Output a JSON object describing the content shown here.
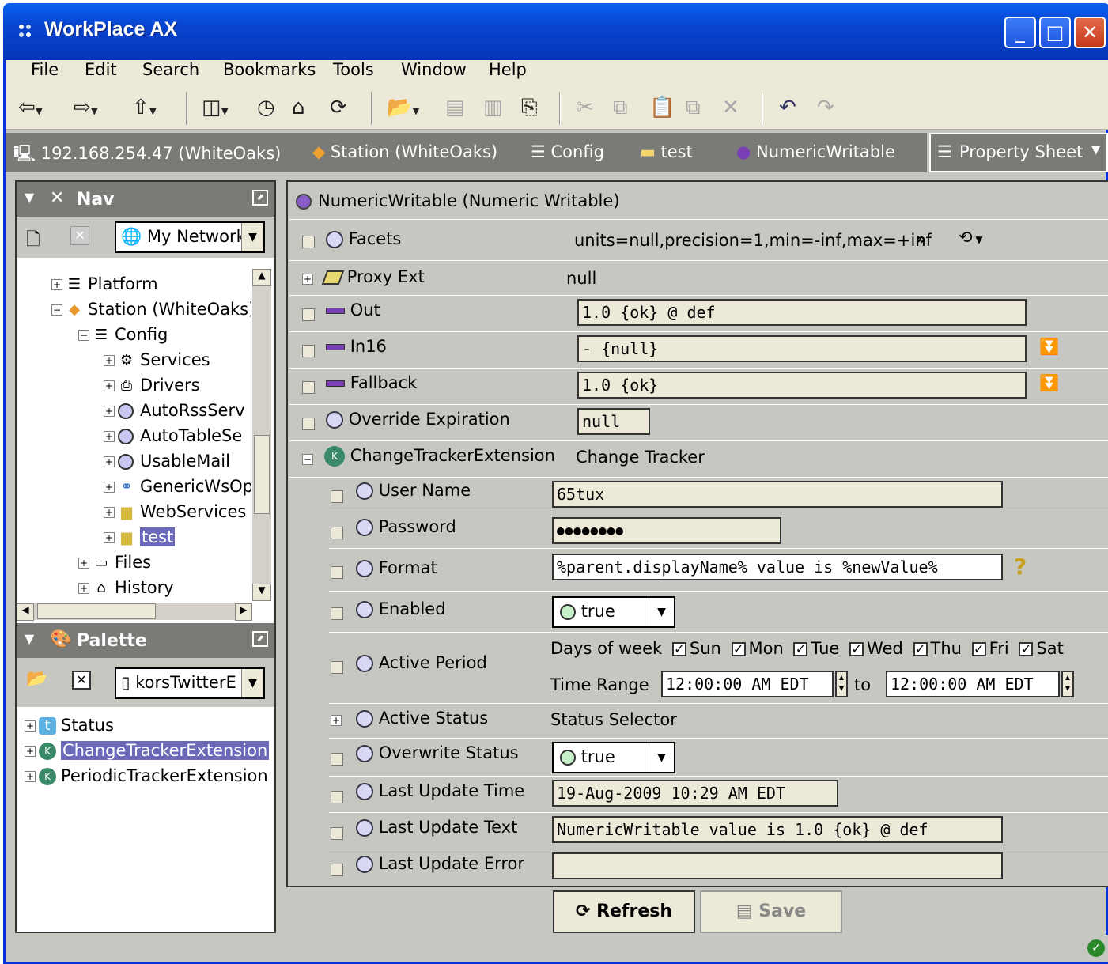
{
  "window": {
    "title": "WorkPlace AX",
    "min": "_",
    "max": "□",
    "close": "✕"
  },
  "menu": [
    "File",
    "Edit",
    "Search",
    "Bookmarks",
    "Tools",
    "Window",
    "Help"
  ],
  "locator": {
    "host": "192.168.254.47 (WhiteOaks)",
    "station": "Station (WhiteOaks)",
    "config": "Config",
    "folder": "test",
    "component": "NumericWritable",
    "view": "Property Sheet"
  },
  "nav": {
    "title": "Nav",
    "network": "My Network",
    "tree": [
      "Platform",
      "Station (WhiteOaks)",
      "Config",
      "Services",
      "Drivers",
      "AutoRssServ",
      "AutoTableSe",
      "UsableMail",
      "GenericWsOp",
      "WebServices",
      "test",
      "Files",
      "History"
    ]
  },
  "palette": {
    "title": "Palette",
    "module": "korsTwitterE",
    "items": [
      "Status",
      "ChangeTrackerExtension",
      "PeriodicTrackerExtension"
    ]
  },
  "sheet": {
    "header": "NumericWritable  (Numeric Writable)",
    "facets_label": "Facets",
    "facets_value": "units=null,precision=1,min=-inf,max=+inf",
    "proxy_label": "Proxy Ext",
    "proxy_value": "null",
    "out_label": "Out",
    "out_value": "1.0 {ok} @ def",
    "in16_label": "In16",
    "in16_value": "- {null}",
    "fallback_label": "Fallback",
    "fallback_value": "1.0 {ok}",
    "override_label": "Override Expiration",
    "override_value": "null",
    "ext_label": "ChangeTrackerExtension",
    "ext_value": "Change Tracker",
    "user_label": "User Name",
    "user_value": "65tux",
    "pass_label": "Password",
    "pass_value": "●●●●●●●●",
    "format_label": "Format",
    "format_value": "%parent.displayName% value is %newValue%",
    "enabled_label": "Enabled",
    "enabled_value": "true",
    "period_label": "Active Period",
    "days_label": "Days of week",
    "days": [
      "Sun",
      "Mon",
      "Tue",
      "Wed",
      "Thu",
      "Fri",
      "Sat"
    ],
    "range_label": "Time Range",
    "range_from": "12:00:00 AM EDT",
    "range_to_label": "to",
    "range_to": "12:00:00 AM EDT",
    "astatus_label": "Active Status",
    "astatus_value": "Status Selector",
    "ostatus_label": "Overwrite Status",
    "ostatus_value": "true",
    "lut_label": "Last Update Time",
    "lut_value": "19-Aug-2009 10:29 AM EDT",
    "lutext_label": "Last Update Text",
    "lutext_value": "NumericWritable value is 1.0 {ok} @ def",
    "lue_label": "Last Update Error",
    "lue_value": ""
  },
  "buttons": {
    "refresh": "Refresh",
    "save": "Save"
  }
}
